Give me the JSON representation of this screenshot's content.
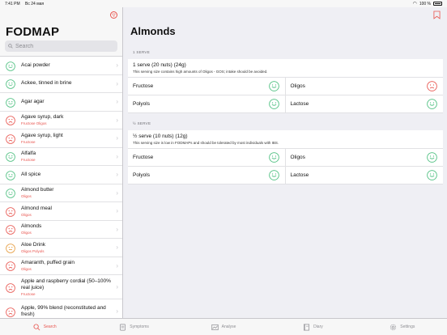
{
  "status": {
    "time": "7:41 PM",
    "date": "Вс 24 мая",
    "battery": "100 %"
  },
  "colors": {
    "accent": "#e8534d",
    "green": "#4cbf7f",
    "amber": "#e59a3a"
  },
  "sidebar": {
    "title": "FODMAP",
    "search_placeholder": "Search",
    "items": [
      {
        "name": "Acai powder",
        "sub": "",
        "rating": "happy"
      },
      {
        "name": "Ackee, tinned in brine",
        "sub": "",
        "rating": "happy"
      },
      {
        "name": "Agar agar",
        "sub": "",
        "rating": "happy"
      },
      {
        "name": "Agave syrup, dark",
        "sub": "Fructose Oligos",
        "rating": "sad"
      },
      {
        "name": "Agave syrup, light",
        "sub": "Fructose",
        "rating": "sad"
      },
      {
        "name": "Alfalfa",
        "sub": "Fructose",
        "rating": "happy"
      },
      {
        "name": "All spice",
        "sub": "",
        "rating": "happy"
      },
      {
        "name": "Almond butter",
        "sub": "Oligos",
        "rating": "happy"
      },
      {
        "name": "Almond meal",
        "sub": "Oligos",
        "rating": "sad"
      },
      {
        "name": "Almonds",
        "sub": "Oligos",
        "rating": "sad"
      },
      {
        "name": "Aloe Drink",
        "sub": "Oligos Polyols",
        "rating": "neutral"
      },
      {
        "name": "Amaranth, puffed grain",
        "sub": "Oligos",
        "rating": "sad"
      },
      {
        "name": "Apple and raspberry cordial (50–100% real juice)",
        "sub": "Fructose",
        "rating": "sad"
      },
      {
        "name": "Apple, 99% blend (reconstituted and fresh)",
        "sub": "",
        "rating": "sad"
      }
    ]
  },
  "main": {
    "title": "Almonds",
    "sections": [
      {
        "label": "1 SERVE",
        "serve": "1 serve (20 nuts) (24g)",
        "desc": "This serving size contains high amounts of Oligos - GOS; intake should be avoided.",
        "cells": [
          {
            "label": "Fructose",
            "rating": "happy"
          },
          {
            "label": "Oligos",
            "rating": "sad"
          },
          {
            "label": "Polyols",
            "rating": "happy"
          },
          {
            "label": "Lactose",
            "rating": "happy"
          }
        ]
      },
      {
        "label": "½ SERVE",
        "serve": "½ serve (10 nuts) (12g)",
        "desc": "This serving size is low in FODMAPs and should be tolerated by most individuals with IBS.",
        "cells": [
          {
            "label": "Fructose",
            "rating": "happy"
          },
          {
            "label": "Oligos",
            "rating": "happy"
          },
          {
            "label": "Polyols",
            "rating": "happy"
          },
          {
            "label": "Lactose",
            "rating": "happy"
          }
        ]
      }
    ]
  },
  "tabs": [
    {
      "label": "Search",
      "icon": "search-icon",
      "active": true
    },
    {
      "label": "Symptoms",
      "icon": "symptoms-icon",
      "active": false
    },
    {
      "label": "Analyse",
      "icon": "analyse-icon",
      "active": false
    },
    {
      "label": "Diary",
      "icon": "diary-icon",
      "active": false
    },
    {
      "label": "Settings",
      "icon": "gear-icon",
      "active": false
    }
  ]
}
